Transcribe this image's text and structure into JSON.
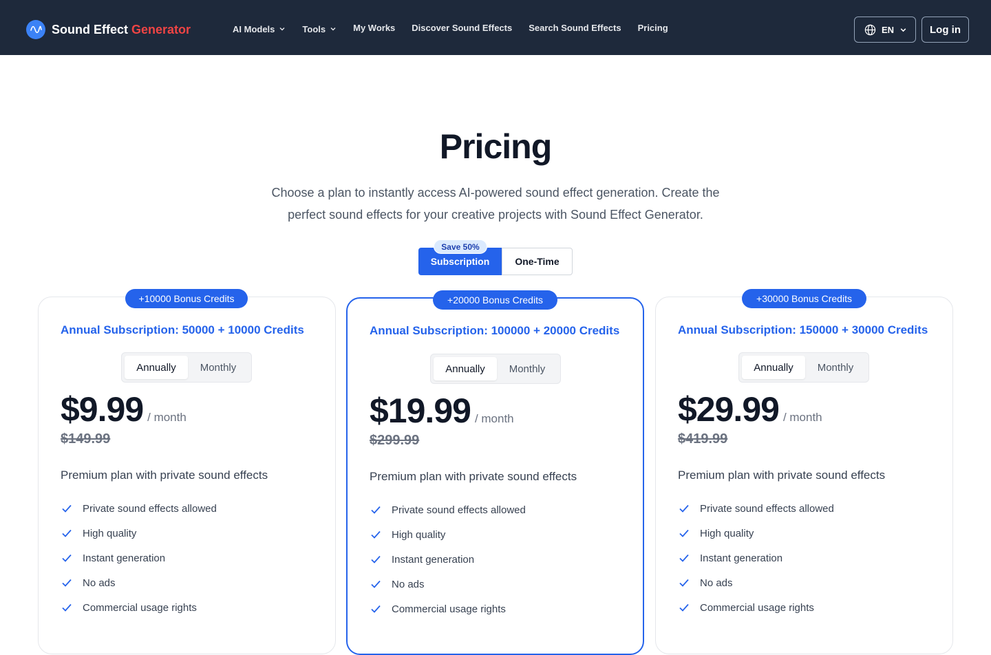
{
  "header": {
    "brand": {
      "name_main": "Sound Effect",
      "name_accent": "Generator",
      "logo_icon": "wave-icon"
    },
    "nav": [
      {
        "label": "AI Models",
        "has_dropdown": true
      },
      {
        "label": "Tools",
        "has_dropdown": true
      },
      {
        "label": "My Works",
        "has_dropdown": false
      },
      {
        "label": "Discover Sound Effects",
        "has_dropdown": false
      },
      {
        "label": "Search Sound Effects",
        "has_dropdown": false
      },
      {
        "label": "Pricing",
        "has_dropdown": false
      }
    ],
    "language": {
      "value": "EN",
      "icon": "globe-icon"
    },
    "login_label": "Log in"
  },
  "hero": {
    "title": "Pricing",
    "subtitle": "Choose a plan to instantly access AI-powered sound effect generation. Create the perfect sound effects for your creative projects with Sound Effect Generator."
  },
  "mode_toggle": {
    "badge": "Save 50%",
    "options": [
      "Subscription",
      "One-Time"
    ],
    "selected": "Subscription"
  },
  "plans": [
    {
      "bonus": "+10000 Bonus Credits",
      "title": "Annual Subscription: 50000 + 10000 Credits",
      "period_options": [
        "Annually",
        "Monthly"
      ],
      "period_selected": "Annually",
      "price": "$9.99",
      "per": "/ month",
      "old_price": "$149.99",
      "description": "Premium plan with private sound effects",
      "features": [
        "Private sound effects allowed",
        "High quality",
        "Instant generation",
        "No ads",
        "Commercial usage rights"
      ],
      "featured": false
    },
    {
      "bonus": "+20000 Bonus Credits",
      "title": "Annual Subscription: 100000 + 20000 Credits",
      "period_options": [
        "Annually",
        "Monthly"
      ],
      "period_selected": "Annually",
      "price": "$19.99",
      "per": "/ month",
      "old_price": "$299.99",
      "description": "Premium plan with private sound effects",
      "features": [
        "Private sound effects allowed",
        "High quality",
        "Instant generation",
        "No ads",
        "Commercial usage rights"
      ],
      "featured": true
    },
    {
      "bonus": "+30000 Bonus Credits",
      "title": "Annual Subscription: 150000 + 30000 Credits",
      "period_options": [
        "Annually",
        "Monthly"
      ],
      "period_selected": "Annually",
      "price": "$29.99",
      "per": "/ month",
      "old_price": "$419.99",
      "description": "Premium plan with private sound effects",
      "features": [
        "Private sound effects allowed",
        "High quality",
        "Instant generation",
        "No ads",
        "Commercial usage rights"
      ],
      "featured": false
    }
  ],
  "colors": {
    "header_bg": "#1e293b",
    "accent": "#2563eb",
    "brand_accent": "#ef4444"
  }
}
